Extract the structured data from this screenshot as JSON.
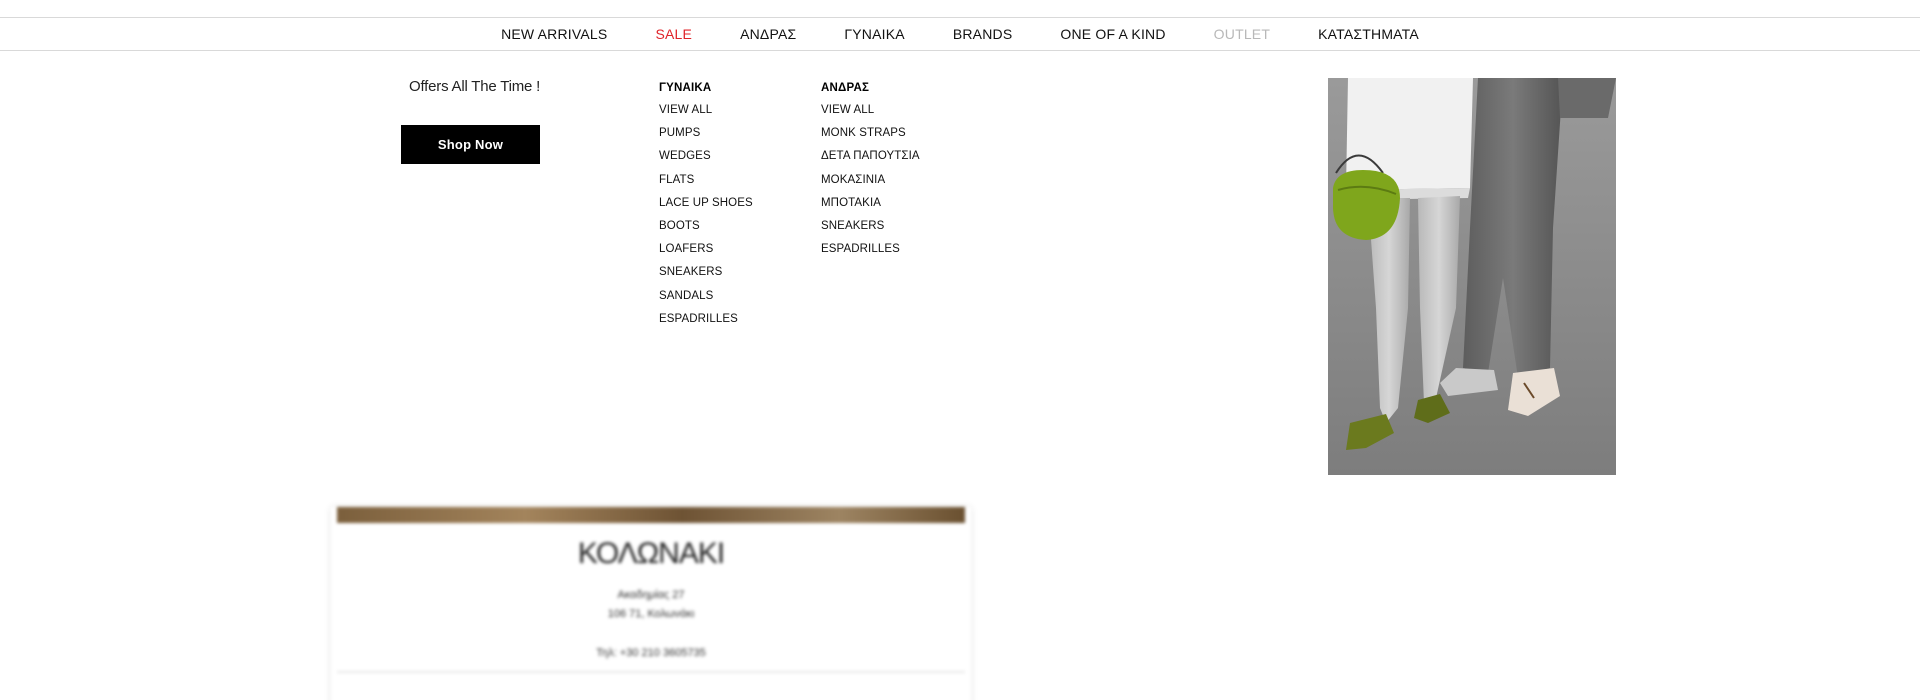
{
  "nav": {
    "items": [
      {
        "label": "NEW ARRIVALS",
        "state": "normal"
      },
      {
        "label": "SALE",
        "state": "sale"
      },
      {
        "label": "ΑΝΔΡΑΣ",
        "state": "normal"
      },
      {
        "label": "ΓΥΝΑΙΚΑ",
        "state": "normal"
      },
      {
        "label": "BRANDS",
        "state": "normal"
      },
      {
        "label": "ONE OF A KIND",
        "state": "normal"
      },
      {
        "label": "OUTLET",
        "state": "muted"
      },
      {
        "label": "ΚΑΤΑΣΤΗΜΑΤΑ",
        "state": "normal"
      }
    ],
    "colors": {
      "sale": "#e0242a",
      "muted": "#b8b8b8"
    }
  },
  "mega_menu": {
    "promo": {
      "title": "Offers All The Time !",
      "button_label": "Shop Now"
    },
    "women": {
      "heading": "ΓΥΝΑΙΚΑ",
      "links": [
        "VIEW ALL",
        "PUMPS",
        "WEDGES",
        "FLATS",
        "LACE UP SHOES",
        "BOOTS",
        "LOAFERS",
        "SNEAKERS",
        "SANDALS",
        "ESPADRILLES"
      ]
    },
    "men": {
      "heading": "ΑΝΔΡΑΣ",
      "links": [
        "VIEW ALL",
        "MONK STRAPS",
        "ΔΕΤΑ ΠΑΠΟΥΤΣΙΑ",
        "ΜΟΚΑΣΙΝΙΑ",
        "ΜΠΟΤΑΚΙΑ",
        "SNEAKERS",
        "ESPADRILLES"
      ]
    },
    "image": {
      "subject": "grayscale photo of legs with green handbag and shoes"
    }
  },
  "store": {
    "title": "ΚΟΛΩΝΑΚΙ",
    "address_line1": "Ακαδημίας 27",
    "address_line2": "106 71, Κολωνάκι",
    "phone": "Τηλ: +30 210 3605735"
  }
}
